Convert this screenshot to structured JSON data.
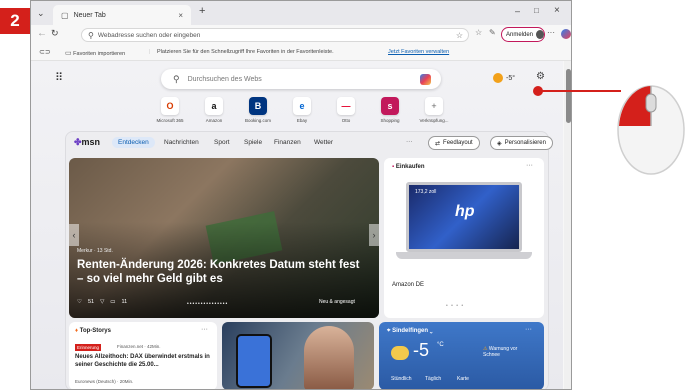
{
  "step_number": "2",
  "browser": {
    "tab_title": "Neuer Tab",
    "address_placeholder": "Webadresse suchen oder eingeben",
    "signin_label": "Anmelden",
    "copilot_label": "Chat",
    "favorites_import": "Favoriten importieren",
    "favorites_hint": "Platzieren Sie für den Schnellzugriff Ihre Favoriten in der Favoritenleiste.",
    "favorites_link": "Jetzt Favoriten verwalten",
    "search_placeholder": "Durchsuchen des Webs",
    "weather_mini": "-5°",
    "quicklinks": [
      {
        "label": "Microsoft 365",
        "glyph": "O",
        "color": "#d83b01"
      },
      {
        "label": "Amazon",
        "glyph": "a",
        "color": "#111111"
      },
      {
        "label": "Booking.com",
        "glyph": "B",
        "color": "#003580"
      },
      {
        "label": "Ebay",
        "glyph": "e",
        "color": "#0064d2"
      },
      {
        "label": "Otto",
        "glyph": "—",
        "color": "#e4002b"
      },
      {
        "label": "Shopping",
        "glyph": "s",
        "color": "#c2185b"
      },
      {
        "label": "Verknüpfung...",
        "glyph": "+",
        "color": "#666666"
      }
    ],
    "feed": {
      "brand": "msn",
      "tabs": [
        "Entdecken",
        "Nachrichten",
        "Sport",
        "Spiele",
        "Finanzen",
        "Wetter"
      ],
      "more": "···",
      "feedlayout_label": "Feedlayout",
      "personalize_label": "Personalisieren",
      "hero": {
        "source": "Merkur · 13 Std.",
        "title": "Renten-Änderung 2026: Konkretes Datum steht fest – so viel mehr Geld gibt es",
        "likes": "51",
        "comments": "11",
        "badge": "Neu & angesagt"
      },
      "shopping": {
        "title": "Einkaufen",
        "price": "173,2 zoll",
        "store": "Amazon DE"
      },
      "topstories": {
        "title": "Top-Storys",
        "tag": "Finanzen.net · 42Min.",
        "tag_label": "Erinnerung",
        "headline": "Neues Allzeithoch: DAX überwindet erstmals in seiner Geschichte die 25.00...",
        "footer": "Euronews (Deutsch) · 20Min."
      },
      "weather": {
        "location": "Sindelfingen",
        "temperature": "-5",
        "unit": "°C",
        "warning": "Warnung vor Schnee",
        "tabs": [
          "Stündlich",
          "Täglich",
          "Karte"
        ]
      }
    }
  },
  "colors": {
    "accent": "#0a5db0",
    "badge": "#d4201b"
  }
}
